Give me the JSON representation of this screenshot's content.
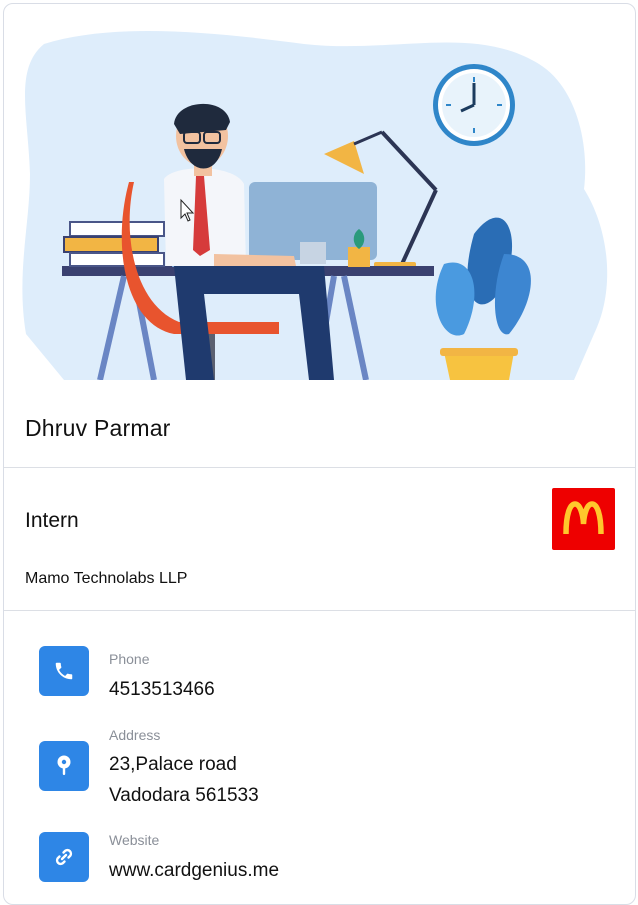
{
  "profile": {
    "name": "Dhruv Parmar",
    "title": "Intern",
    "company": "Mamo Technolabs LLP"
  },
  "contacts": {
    "phone": {
      "label": "Phone",
      "value": "4513513466",
      "icon": "phone-icon"
    },
    "address": {
      "label": "Address",
      "line1": "23,Palace road",
      "line2": "Vadodara 561533",
      "icon": "location-pin-icon"
    },
    "website": {
      "label": "Website",
      "value": "www.cardgenius.me",
      "icon": "link-icon"
    }
  },
  "colors": {
    "accent": "#2e86e6",
    "logo_bg": "#ee0000",
    "logo_fg": "#ffc72c",
    "hero_blob": "#deedfb"
  },
  "logo": {
    "brand": "McDonald's golden arches"
  }
}
